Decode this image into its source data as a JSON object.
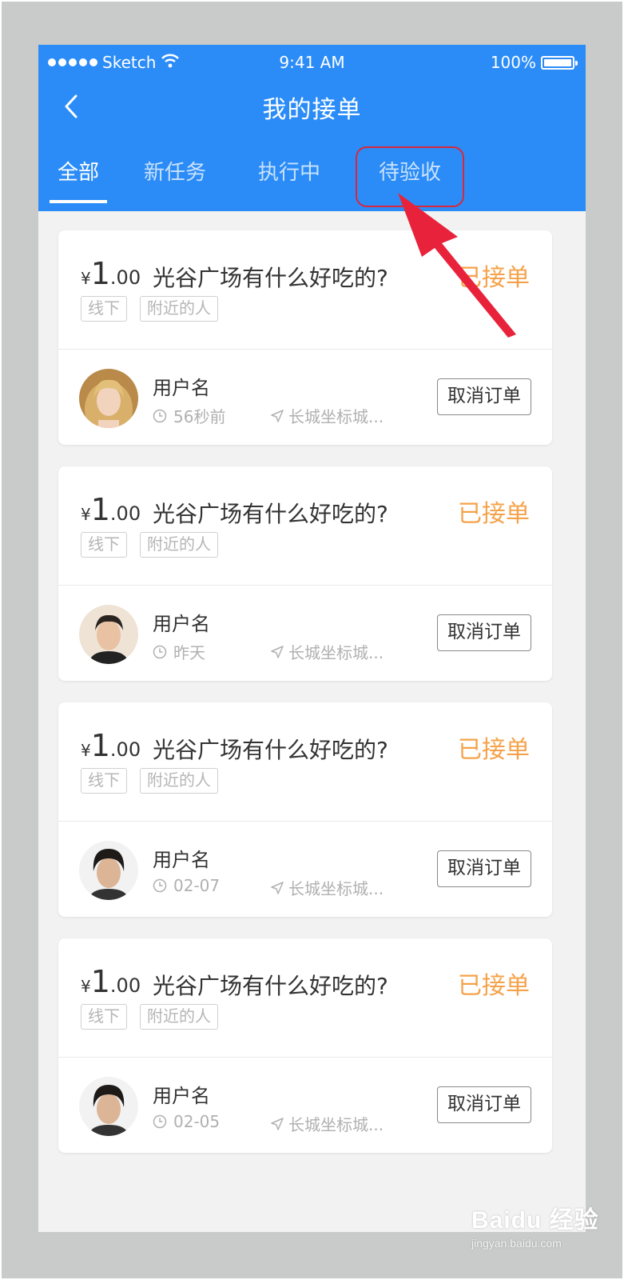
{
  "statusbar": {
    "carrier": "Sketch",
    "time": "9:41 AM",
    "battery": "100%"
  },
  "header": {
    "title": "我的接单"
  },
  "tabs": [
    {
      "label": "全部",
      "active": true
    },
    {
      "label": "新任务",
      "active": false
    },
    {
      "label": "执行中",
      "active": false
    },
    {
      "label": "待验收",
      "active": false,
      "highlighted": true
    }
  ],
  "colors": {
    "header": "#2b8cf7",
    "status": "#f5a24a",
    "highlight": "#d9283b"
  },
  "orders": [
    {
      "price_currency": "¥",
      "price_int": "1",
      "price_dec": ".00",
      "title": "光谷广场有什么好吃的?",
      "status": "已接单",
      "tags": [
        "线下",
        "附近的人"
      ],
      "user": "用户名",
      "time": "56秒前",
      "location": "长城坐标城...",
      "cancel_label": "取消订单",
      "avatar": "woman-avatar"
    },
    {
      "price_currency": "¥",
      "price_int": "1",
      "price_dec": ".00",
      "title": "光谷广场有什么好吃的?",
      "status": "已接单",
      "tags": [
        "线下",
        "附近的人"
      ],
      "user": "用户名",
      "time": "昨天",
      "location": "长城坐标城...",
      "cancel_label": "取消订单",
      "avatar": "man-avatar"
    },
    {
      "price_currency": "¥",
      "price_int": "1",
      "price_dec": ".00",
      "title": "光谷广场有什么好吃的?",
      "status": "已接单",
      "tags": [
        "线下",
        "附近的人"
      ],
      "user": "用户名",
      "time": "02-07",
      "location": "长城坐标城...",
      "cancel_label": "取消订单",
      "avatar": "man-avatar"
    },
    {
      "price_currency": "¥",
      "price_int": "1",
      "price_dec": ".00",
      "title": "光谷广场有什么好吃的?",
      "status": "已接单",
      "tags": [
        "线下",
        "附近的人"
      ],
      "user": "用户名",
      "time": "02-05",
      "location": "长城坐标城...",
      "cancel_label": "取消订单",
      "avatar": "man-avatar"
    }
  ],
  "watermark": {
    "logo": "Baidu 经验",
    "url": "jingyan.baidu.com"
  }
}
